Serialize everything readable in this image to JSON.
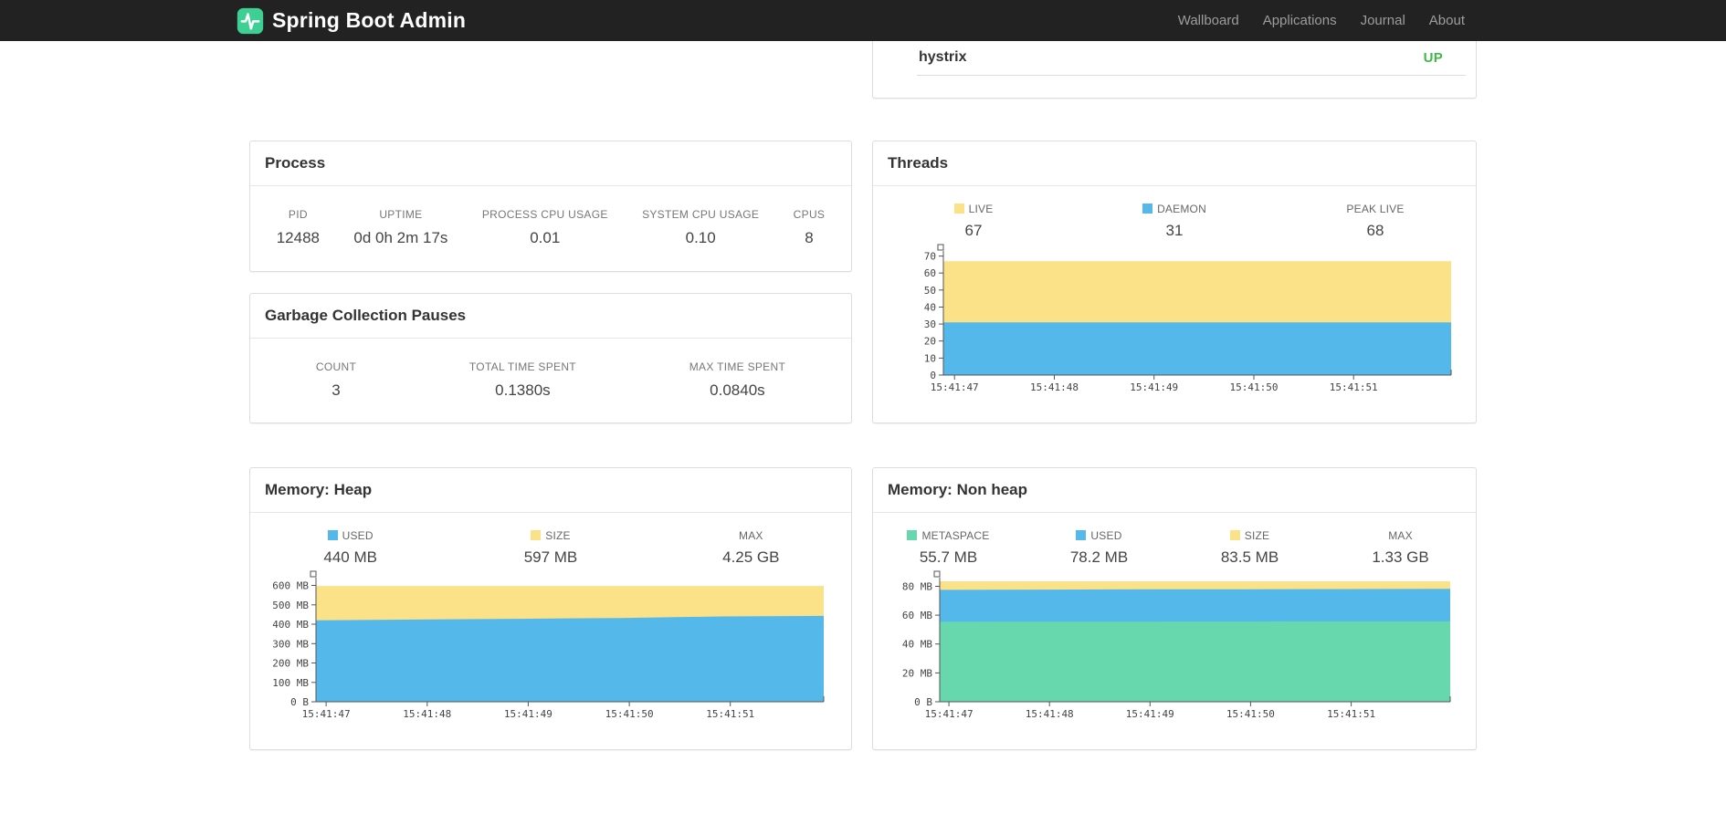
{
  "navbar": {
    "brand": "Spring Boot Admin",
    "brand_color": "#3ecf94",
    "links": [
      {
        "id": "wallboard",
        "label": "Wallboard"
      },
      {
        "id": "applications",
        "label": "Applications"
      },
      {
        "id": "journal",
        "label": "Journal"
      },
      {
        "id": "about",
        "label": "About"
      }
    ]
  },
  "status_panel": {
    "service": "hystrix",
    "status": "UP",
    "status_color": "#43b649"
  },
  "panels": {
    "process": {
      "title": "Process",
      "metrics": [
        {
          "label": "PID",
          "value": "12488"
        },
        {
          "label": "UPTIME",
          "value": "0d 0h 2m 17s"
        },
        {
          "label": "PROCESS CPU USAGE",
          "value": "0.01"
        },
        {
          "label": "SYSTEM CPU USAGE",
          "value": "0.10"
        },
        {
          "label": "CPUS",
          "value": "8"
        }
      ]
    },
    "gc": {
      "title": "Garbage Collection Pauses",
      "metrics": [
        {
          "label": "COUNT",
          "value": "3"
        },
        {
          "label": "TOTAL TIME SPENT",
          "value": "0.1380s"
        },
        {
          "label": "MAX TIME SPENT",
          "value": "0.0840s"
        }
      ]
    },
    "threads": {
      "title": "Threads",
      "legend": [
        {
          "label": "LIVE",
          "color": "#fbe187",
          "value": "67"
        },
        {
          "label": "DAEMON",
          "color": "#54b9ea",
          "value": "31"
        },
        {
          "label": "PEAK LIVE",
          "color": null,
          "value": "68"
        }
      ]
    },
    "heap": {
      "title": "Memory: Heap",
      "legend": [
        {
          "label": "USED",
          "color": "#54b9ea",
          "value": "440 MB"
        },
        {
          "label": "SIZE",
          "color": "#fbe187",
          "value": "597 MB"
        },
        {
          "label": "MAX",
          "color": null,
          "value": "4.25 GB"
        }
      ]
    },
    "nonheap": {
      "title": "Memory: Non heap",
      "legend": [
        {
          "label": "METASPACE",
          "color": "#67d7ae",
          "value": "55.7 MB"
        },
        {
          "label": "USED",
          "color": "#54b9ea",
          "value": "78.2 MB"
        },
        {
          "label": "SIZE",
          "color": "#fbe187",
          "value": "83.5 MB"
        },
        {
          "label": "MAX",
          "color": null,
          "value": "1.33 GB"
        }
      ]
    }
  },
  "chart_data": [
    {
      "id": "threads",
      "type": "area",
      "title": "Threads",
      "mode": "overlay-absolute",
      "grid": false,
      "legend_position": "top",
      "x_labels": [
        "15:41:47",
        "15:41:48",
        "15:41:49",
        "15:41:50",
        "15:41:51"
      ],
      "ylim": [
        0,
        73
      ],
      "y_ticks": [
        0,
        10,
        20,
        30,
        40,
        50,
        60,
        70
      ],
      "y_tick_labels": [
        "0",
        "10",
        "20",
        "30",
        "40",
        "50",
        "60",
        "70"
      ],
      "series": [
        {
          "name": "LIVE",
          "color": "#fbe187",
          "values": [
            67,
            67,
            67,
            67,
            67,
            67
          ]
        },
        {
          "name": "DAEMON",
          "color": "#54b9ea",
          "values": [
            31,
            31,
            31,
            31,
            31,
            31
          ]
        }
      ]
    },
    {
      "id": "heap",
      "type": "area",
      "title": "Memory: Heap",
      "mode": "overlay-absolute",
      "grid": false,
      "legend_position": "top",
      "x_labels": [
        "15:41:47",
        "15:41:48",
        "15:41:49",
        "15:41:50",
        "15:41:51"
      ],
      "ylim": [
        0,
        640
      ],
      "y_ticks": [
        0,
        100,
        200,
        300,
        400,
        500,
        600
      ],
      "y_tick_labels": [
        "0 B",
        "100 MB",
        "200 MB",
        "300 MB",
        "400 MB",
        "500 MB",
        "600 MB"
      ],
      "series": [
        {
          "name": "SIZE",
          "color": "#fbe187",
          "values": [
            597,
            597,
            597,
            597,
            597,
            597
          ]
        },
        {
          "name": "USED",
          "color": "#54b9ea",
          "values": [
            420,
            424,
            428,
            432,
            440,
            443
          ]
        }
      ]
    },
    {
      "id": "nonheap",
      "type": "area",
      "title": "Memory: Non heap",
      "mode": "overlay-absolute",
      "grid": false,
      "legend_position": "top",
      "x_labels": [
        "15:41:47",
        "15:41:48",
        "15:41:49",
        "15:41:50",
        "15:41:51"
      ],
      "ylim": [
        0,
        86
      ],
      "y_ticks": [
        0,
        20,
        40,
        60,
        80
      ],
      "y_tick_labels": [
        "0 B",
        "20 MB",
        "40 MB",
        "60 MB",
        "80 MB"
      ],
      "series": [
        {
          "name": "SIZE",
          "color": "#fbe187",
          "values": [
            83.5,
            83.5,
            83.5,
            83.5,
            83.5,
            83.5
          ]
        },
        {
          "name": "USED",
          "color": "#54b9ea",
          "values": [
            77.5,
            77.7,
            77.9,
            78.0,
            78.1,
            78.2
          ]
        },
        {
          "name": "METASPACE",
          "color": "#67d7ae",
          "values": [
            55.4,
            55.5,
            55.5,
            55.6,
            55.7,
            55.7
          ]
        }
      ]
    }
  ]
}
